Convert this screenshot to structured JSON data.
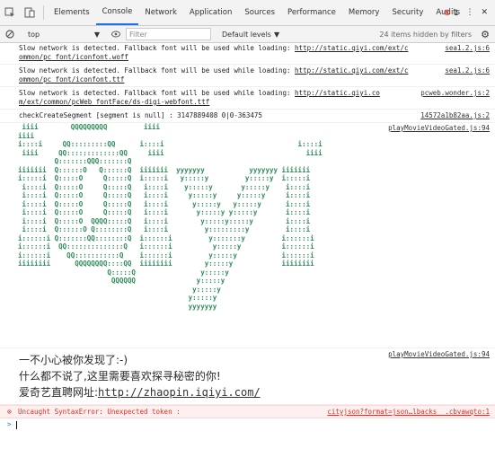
{
  "tabbar": {
    "tabs": [
      "Elements",
      "Console",
      "Network",
      "Application",
      "Sources",
      "Performance",
      "Memory",
      "Security",
      "Audits"
    ],
    "active_tab": "Console",
    "error_count": "1",
    "icons": [
      "inspect-icon",
      "device-toggle-icon",
      "error-icon",
      "more-icon",
      "close-icon"
    ]
  },
  "toolbar": {
    "context": "top",
    "filter_placeholder": "Filter",
    "levels": "Default levels",
    "hidden_count": "24 items hidden by filters"
  },
  "messages": [
    {
      "text_a": "Slow network is detected. Fallback font will be used while loading: ",
      "url_a": "http://static.qiyi.com/ext/c",
      "url_b": "ommon/pc_font/iconfont.woff",
      "source": "sea1.2.js:6"
    },
    {
      "text_a": "Slow network is detected. Fallback font will be used while loading: ",
      "url_a": "http://static.qiyi.com/ext/c",
      "url_b": "ommon/pc_font/iconfont.ttf",
      "source": "sea1.2.js:6"
    },
    {
      "text_a": "Slow network is detected. Fallback font will be used while loading: ",
      "url_a": "http://static.qiyi.co",
      "url_b": "m/ext/common/pcWeb_fontFace/ds-digi-webfont.ttf",
      "source": "pcweb.wonder.js:2"
    },
    {
      "text_a": "checkCreateSegment [segment is null] : 3147889408 0|0-363475",
      "url_a": "",
      "url_b": "",
      "source": "14572a1b82aa.js:2"
    }
  ],
  "ascii_source": "playMovieVideoGated.js:94",
  "ascii_art": " iiii        QQQQQQQQQ         iiii\niiii\ni::::i     QQ:::::::::QQ      i::::i                                 i::::i\n iiii     QQ:::::::::::::QQ     iiii                                   iiii\n         Q:::::::QQQ:::::::Q\niiiiiii  Q::::::O   Q::::::Q  iiiiiii  yyyyyyy           yyyyyyy iiiiiii\ni:::::i  Q:::::O     Q:::::Q  i:::::i   y:::::y         y:::::y  i:::::i\n i::::i  Q:::::O     Q:::::Q   i::::i    y:::::y       y:::::y    i::::i\n i::::i  Q:::::O     Q:::::Q   i::::i     y:::::y     y:::::y     i::::i\n i::::i  Q:::::O     Q:::::Q   i::::i      y:::::y   y:::::y      i::::i\n i::::i  Q:::::O     Q:::::Q   i::::i       y:::::y y:::::y       i::::i\n i::::i  Q:::::O  QQQQ:::::Q   i::::i        y:::::y:::::y        i::::i\n i::::i  Q::::::O Q::::::::Q   i::::i         y:::::::::y         i::::i\ni::::::i Q:::::::QQ::::::::Q  i::::::i         y:::::::y         i::::::i\ni::::::i  QQ::::::::::::::Q   i::::::i          y:::::y          i::::::i\ni::::::i    QQ:::::::::::Q    i::::::i         y:::::y           i::::::i\niiiiiiii      QQQQQQQQ::::QQ  iiiiiiii        y:::::y            iiiiiiii\n                      Q:::::Q                y:::::y\n                       QQQQQQ               y:::::y\n                                           y:::::y\n                                          y:::::y\n                                          yyyyyyy",
  "chinese": {
    "source": "playMovieVideoGated.js:94",
    "line1": "一不小心被你发现了:-)",
    "line2": "什么都不说了,这里需要喜欢探寻秘密的你!",
    "line3_prefix": "爱奇艺直聘网址:",
    "line3_link": "http://zhaopin.iqiyi.com/"
  },
  "error": {
    "text": "Uncaught SyntaxError: Unexpected token :",
    "source": "cityjson?format=json…lbacks__.cbvawqto:1"
  },
  "prompt_symbol": ">",
  "colors": {
    "ascii": "#2e8b57",
    "error": "#d93025",
    "active_tab": "#1a73e8"
  }
}
